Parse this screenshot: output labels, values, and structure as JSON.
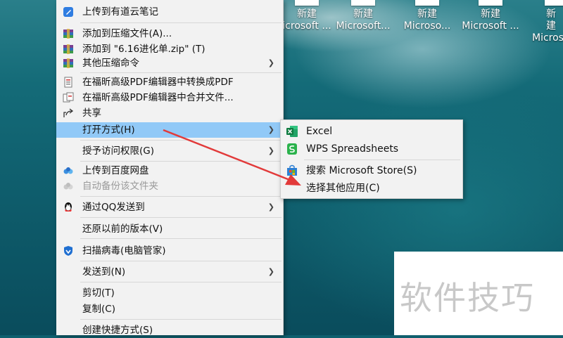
{
  "desktop": {
    "icons": [
      {
        "line1": "新建",
        "line2": "icrosoft ..."
      },
      {
        "line1": "新建",
        "line2": "Microsoft..."
      },
      {
        "line1": "新建",
        "line2": "Microso..."
      },
      {
        "line1": "新建",
        "line2": "Microsoft ..."
      },
      {
        "line1": "新建",
        "line2": "Micros"
      }
    ]
  },
  "context_menu": {
    "items": [
      {
        "label": "上传到有道云笔记",
        "icon": "youdao-note-icon"
      },
      {
        "label": "添加到压缩文件(A)...",
        "icon": "winrar-icon"
      },
      {
        "label": "添加到 \"6.16进化单.zip\" (T)",
        "icon": "winrar-icon"
      },
      {
        "label": "其他压缩命令",
        "icon": "winrar-icon",
        "submenu": true
      },
      {
        "label": "在福昕高级PDF编辑器中转换成PDF",
        "icon": "foxit-convert-icon"
      },
      {
        "label": "在福昕高级PDF编辑器中合并文件...",
        "icon": "foxit-merge-icon"
      },
      {
        "label": "共享",
        "icon": "share-icon"
      },
      {
        "label": "打开方式(H)",
        "submenu": true,
        "highlighted": true
      },
      {
        "label": "授予访问权限(G)",
        "submenu": true
      },
      {
        "label": "上传到百度网盘",
        "icon": "baidu-netdisk-icon"
      },
      {
        "label": "自动备份该文件夹",
        "icon": "baidu-netdisk-icon",
        "disabled": true
      },
      {
        "label": "通过QQ发送到",
        "icon": "qq-icon",
        "submenu": true
      },
      {
        "label": "还原以前的版本(V)"
      },
      {
        "label": "扫描病毒(电脑管家)",
        "icon": "tencent-pc-manager-icon"
      },
      {
        "label": "发送到(N)",
        "submenu": true
      },
      {
        "label": "剪切(T)"
      },
      {
        "label": "复制(C)"
      },
      {
        "label": "创建快捷方式(S)"
      }
    ]
  },
  "open_with_submenu": {
    "items": [
      {
        "label": "Excel",
        "icon": "excel-icon"
      },
      {
        "label": "WPS Spreadsheets",
        "icon": "wps-spreadsheets-icon"
      },
      {
        "label": "搜索 Microsoft Store(S)",
        "icon": "microsoft-store-icon"
      },
      {
        "label": "选择其他应用(C)"
      }
    ]
  },
  "watermark": {
    "text": "软件技巧"
  },
  "colors": {
    "highlight": "#91c9f7",
    "annotation_arrow": "#e23a3a",
    "excel_green": "#1d7a45",
    "wps_green": "#2bb24c"
  }
}
